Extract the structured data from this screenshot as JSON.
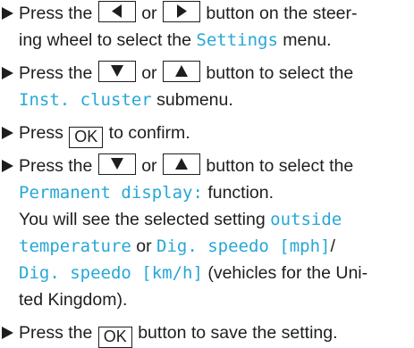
{
  "steps": [
    {
      "lines": [
        {
          "before": "Press the ",
          "between": " or ",
          "after": " button on the steer-"
        },
        {
          "a": "ing wheel to select the ",
          "b": "Settings",
          "c": " menu."
        }
      ],
      "keys": [
        "left-triangle",
        "right-triangle"
      ]
    },
    {
      "lines": [
        {
          "before": "Press the ",
          "between": " or ",
          "after": " button to select the"
        },
        {
          "b": "Inst. cluster",
          "c": " submenu."
        }
      ],
      "keys": [
        "down-triangle",
        "up-triangle"
      ]
    },
    {
      "lines": [
        {
          "before": "Press ",
          "key": "OK",
          "after": " to confirm."
        }
      ]
    },
    {
      "lines": [
        {
          "before": "Press the ",
          "between": " or ",
          "after": " button to select the"
        },
        {
          "b": "Permanent display:",
          "c": " function."
        },
        {
          "a": "You will see the selected setting ",
          "b": "outside"
        },
        {
          "b": "temperature",
          "c": " or ",
          "d": "Dig. speedo [mph]",
          "e": "/"
        },
        {
          "b": "Dig. speedo [km/h]",
          "c": " (vehicles for the Uni-"
        },
        {
          "a": "ted Kingdom)."
        }
      ],
      "keys": [
        "down-triangle",
        "up-triangle"
      ]
    },
    {
      "lines": [
        {
          "before": "Press the ",
          "key": "OK",
          "after": " button to save the setting."
        }
      ]
    }
  ],
  "colors": {
    "text": "#1e1e1e",
    "highlight": "#27a7d6"
  },
  "icons": {
    "bullet": "right-pointing-triangle-bullet"
  }
}
